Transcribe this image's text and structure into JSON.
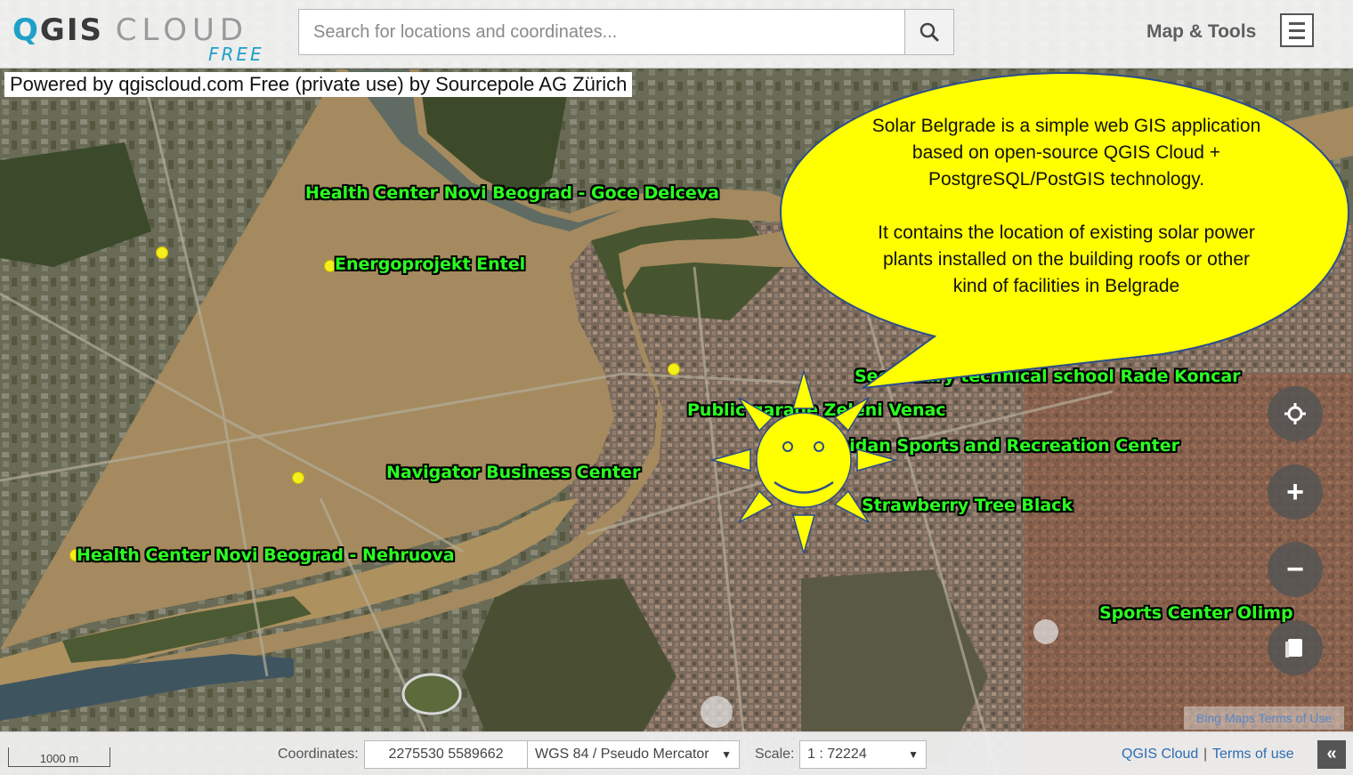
{
  "header": {
    "logo_main": "QGIS",
    "logo_cloud": "CLOUD",
    "logo_edition": "FREE",
    "search_placeholder": "Search for locations and coordinates...",
    "tools_label": "Map & Tools"
  },
  "powered_by": "Powered by qgiscloud.com Free (private use) by Sourcepole AG Zürich",
  "map_labels": [
    "Health Center Novi Beograd - Goce Delceva",
    "Energoprojekt Entel",
    "Secondary technical school Rade Koncar",
    "Public garage Zeleni Venac",
    "Tasmaidan Sports and Recreation Center",
    "Navigator Business Center",
    "Strawberry Tree Black",
    "Health Center Novi Beograd - Nehruova",
    "Sports Center Olimp"
  ],
  "callout": {
    "paragraph_1": "Solar Belgrade is a simple web GIS application based on open-source QGIS Cloud + PostgreSQL/PostGIS technology.",
    "paragraph_2": "It contains the location of existing solar power plants installed on the building roofs or other kind of facilities in Belgrade",
    "fill_color": "#ffff00"
  },
  "map_controls": {
    "locate_icon": "crosshair-icon",
    "zoom_in": "+",
    "zoom_out": "−",
    "layers_icon": "layers-icon"
  },
  "attribution": "Bing Maps Terms of Use",
  "footer": {
    "scale_bar": "1000 m",
    "coordinates_label": "Coordinates:",
    "coordinates_value": "2275530 5589662",
    "crs": "WGS 84 / Pseudo Mercator",
    "scale_label": "Scale:",
    "scale_value": "1 : 72224",
    "qgis_link": "QGIS Cloud",
    "separator": "|",
    "terms_link": "Terms of use",
    "collapse": "«"
  },
  "colors": {
    "label_green": "#2bff22",
    "point_yellow": "#f4ef1a",
    "river": "#a48a5e",
    "link_blue": "#2c6db5"
  }
}
